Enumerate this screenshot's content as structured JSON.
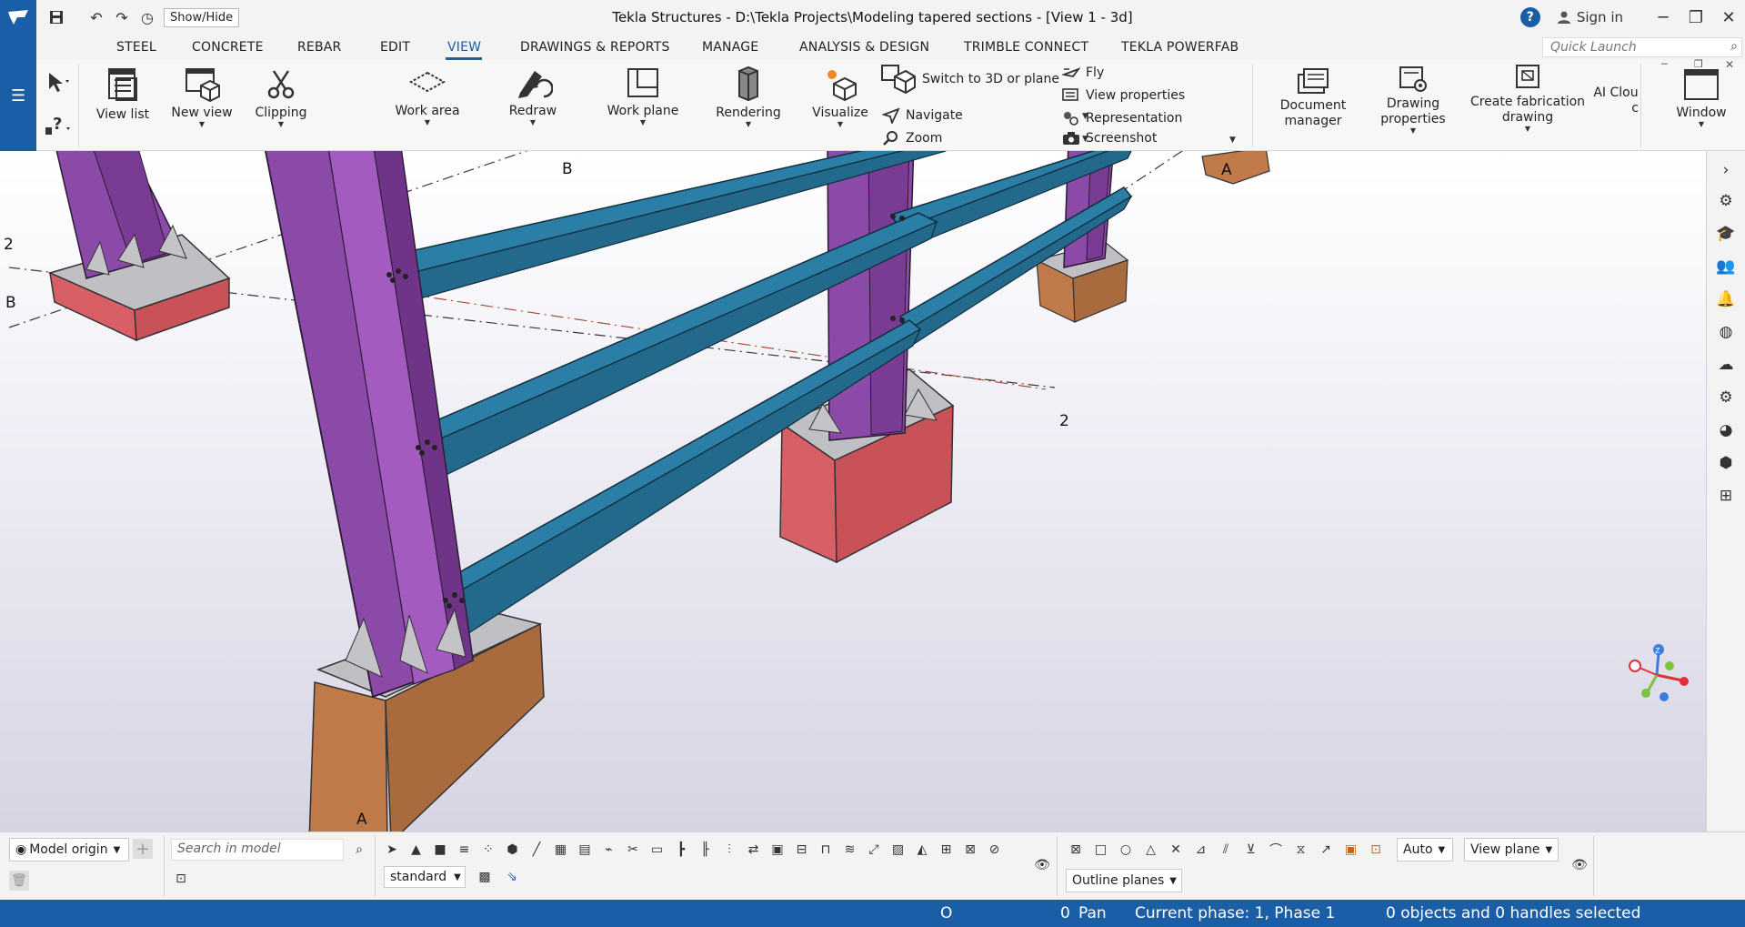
{
  "titlebar": {
    "title": "Tekla Structures - D:\\Tekla Projects\\Modeling tapered sections  - [View 1 - 3d]",
    "show_hide": "Show/Hide",
    "sign_in": "Sign in"
  },
  "menu": {
    "tabs": [
      "STEEL",
      "CONCRETE",
      "REBAR",
      "EDIT",
      "VIEW",
      "DRAWINGS & REPORTS",
      "MANAGE",
      "ANALYSIS & DESIGN",
      "TRIMBLE CONNECT",
      "TEKLA POWERFAB"
    ],
    "active": "VIEW",
    "quick_launch_placeholder": "Quick Launch"
  },
  "ribbon": {
    "view_list": "View list",
    "new_view": "New view",
    "clipping": "Clipping",
    "work_area": "Work area",
    "redraw": "Redraw",
    "work_plane": "Work plane",
    "rendering": "Rendering",
    "visualize": "Visualize",
    "switch_3d": "Switch to 3D or plane",
    "navigate": "Navigate",
    "zoom": "Zoom",
    "fly": "Fly",
    "view_properties": "View properties",
    "representation": "Representation",
    "screenshot": "Screenshot",
    "document_manager_1": "Document",
    "document_manager_2": "manager",
    "drawing_properties_1": "Drawing",
    "drawing_properties_2": "properties",
    "create_fab_1": "Create fabrication",
    "create_fab_2": "drawing",
    "ai_cloud_1": "AI Clou",
    "ai_cloud_2": "c",
    "window": "Window"
  },
  "viewport": {
    "grid_labels": {
      "b_top": "B",
      "two_left": "2",
      "b_left": "B",
      "a_right": "A",
      "two_mid": "2",
      "a_bottom": "A"
    },
    "colors": {
      "column": "#8c4aa8",
      "beam": "#2b7fa6",
      "footing": "#d85f66",
      "footing_right": "#b07447"
    },
    "axes": {
      "z": "Z"
    }
  },
  "bottombar": {
    "model_origin": "Model origin",
    "search_placeholder": "Search in model",
    "standard": "standard",
    "auto": "Auto",
    "view_plane": "View plane",
    "outline_planes": "Outline planes"
  },
  "statusbar": {
    "o": "O",
    "pan_num": "0",
    "pan": "Pan",
    "phase": "Current phase: 1, Phase 1",
    "selection": "0 objects and 0 handles selected"
  }
}
